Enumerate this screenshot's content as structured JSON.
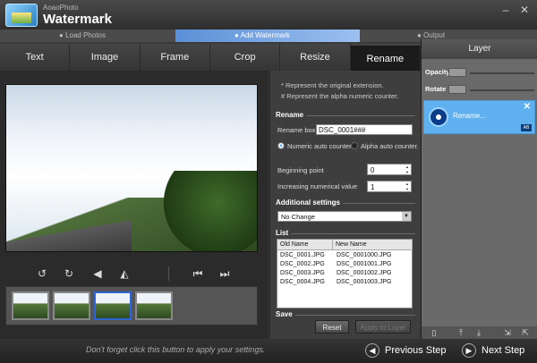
{
  "app": {
    "brand_small": "AoaoPhoto",
    "brand_name": "Watermark",
    "window_controls": {
      "minimize": "–",
      "close": "✕"
    }
  },
  "steps": [
    {
      "label": "Load Photos",
      "active": false
    },
    {
      "label": "Add Watermark",
      "active": true
    },
    {
      "label": "Output",
      "active": false
    }
  ],
  "tabs": [
    {
      "label": "Text",
      "active": false
    },
    {
      "label": "Image",
      "active": false
    },
    {
      "label": "Frame",
      "active": false
    },
    {
      "label": "Crop",
      "active": false
    },
    {
      "label": "Resize",
      "active": false
    },
    {
      "label": "Rename",
      "active": true
    }
  ],
  "preview": {
    "tool_icons": [
      "rotate-left-icon",
      "rotate-right-icon",
      "flip-horizontal-icon",
      "flip-vertical-icon",
      "previous-photo-icon",
      "next-photo-icon"
    ],
    "thumbnails": [
      {
        "selected": false
      },
      {
        "selected": false
      },
      {
        "selected": true
      },
      {
        "selected": false
      }
    ]
  },
  "rename": {
    "note1": "* Represent the original extension.",
    "note2": "# Represent the alpha numeric counter.",
    "section_title": "Rename",
    "rename_box_label": "Rename box:",
    "rename_box_value": "DSC_0001###",
    "numeric_label": "Numeric auto counter.",
    "alpha_label": "Alpha auto counter.",
    "counter_mode": "numeric",
    "beginning_label": "Beginning point",
    "beginning_value": "0",
    "increment_label": "Increasing numerical value",
    "increment_value": "1",
    "additional_title": "Additional settings",
    "additional_value": "No Change",
    "list_title": "List",
    "col_old": "Old Name",
    "col_new": "New Name",
    "rows": [
      {
        "old": "DSC_0001.JPG",
        "new": "DSC_0001000.JPG"
      },
      {
        "old": "DSC_0002.JPG",
        "new": "DSC_0001001.JPG"
      },
      {
        "old": "DSC_0003.JPG",
        "new": "DSC_0001002.JPG"
      },
      {
        "old": "DSC_0004.JPG",
        "new": "DSC_0001003.JPG"
      }
    ],
    "save_title": "Save",
    "reset_label": "Reset",
    "apply_label": "Apply to Layer"
  },
  "layer": {
    "title": "Layer",
    "opacity_label": "Opacity",
    "rotate_label": "Rotate",
    "item_label": "Rename...",
    "item_badge": "AB",
    "close_glyph": "✕"
  },
  "footer": {
    "hint": "Don't forget click this button to apply your settings.",
    "prev_label": "Previous Step",
    "next_label": "Next Step"
  },
  "colors": {
    "accent": "#5fb0ee",
    "step_active": "#5b8fd6",
    "selected_thumb": "#2f63d8"
  }
}
